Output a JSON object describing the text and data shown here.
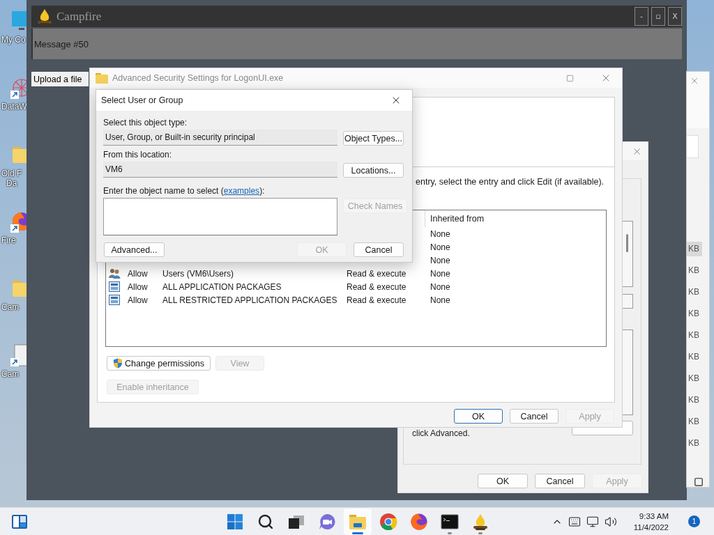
{
  "desktop": {
    "icons": [
      {
        "kind": "monitor",
        "shortcut": false,
        "lines": [
          "My Co"
        ]
      },
      {
        "kind": "web",
        "shortcut": true,
        "lines": [
          "DataW"
        ]
      },
      {
        "kind": "folder",
        "shortcut": false,
        "lines": [
          "Old F",
          "Da"
        ]
      },
      {
        "kind": "firefox",
        "shortcut": true,
        "lines": [
          "Fire"
        ]
      },
      {
        "kind": "folder",
        "shortcut": false,
        "lines": [
          "Cam"
        ]
      },
      {
        "kind": "file",
        "shortcut": true,
        "lines": [
          "Cam"
        ]
      }
    ]
  },
  "campfire": {
    "title": "Campfire",
    "controls": [
      "-",
      "▫",
      "X"
    ],
    "message": "Message #50",
    "upload_button": "Upload a file"
  },
  "right_window": {
    "rows": [
      {
        "size": "KB",
        "selected": true
      },
      {
        "size": "KB",
        "selected": false
      },
      {
        "size": "KB",
        "selected": false
      },
      {
        "size": "KB",
        "selected": false
      },
      {
        "size": "KB",
        "selected": false
      },
      {
        "size": "KB",
        "selected": false
      },
      {
        "size": "KB",
        "selected": false
      },
      {
        "size": "KB",
        "selected": false
      },
      {
        "size": "KB",
        "selected": false
      },
      {
        "size": "KB",
        "selected": false
      }
    ]
  },
  "properties_window": {
    "text": "click Advanced.",
    "footer": [
      {
        "label": "OK",
        "disabled": false
      },
      {
        "label": "Cancel",
        "disabled": false
      },
      {
        "label": "Apply",
        "disabled": true
      }
    ]
  },
  "security_window": {
    "title": "Advanced Security Settings for LogonUI.exe",
    "active": false,
    "instruction": "entry, select the entry and click Edit (if available).",
    "table": {
      "header": "Inherited from",
      "rows": [
        {
          "inherited": "None"
        },
        {
          "inherited": "None"
        },
        {
          "inherited": "None"
        },
        {
          "kind": "group",
          "type": "Allow",
          "principal": "Users (VM6\\Users)",
          "access": "Read & execute",
          "inherited": "None"
        },
        {
          "kind": "package",
          "type": "Allow",
          "principal": "ALL APPLICATION PACKAGES",
          "access": "Read & execute",
          "inherited": "None"
        },
        {
          "kind": "package",
          "type": "Allow",
          "principal": "ALL RESTRICTED APPLICATION PACKAGES",
          "access": "Read & execute",
          "inherited": "None"
        }
      ]
    },
    "buttons": [
      {
        "label": "Change permissions",
        "shield": true,
        "disabled": false
      },
      {
        "label": "View",
        "shield": false,
        "disabled": true
      }
    ],
    "inheritance_button": {
      "label": "Enable inheritance",
      "disabled": true
    },
    "footer": [
      {
        "label": "OK",
        "default": true,
        "disabled": false
      },
      {
        "label": "Cancel",
        "default": false,
        "disabled": false
      },
      {
        "label": "Apply",
        "default": false,
        "disabled": true
      }
    ]
  },
  "select_dialog": {
    "title": "Select User or Group",
    "object_type": {
      "label": "Select this object type:",
      "value": "User, Group, or Built-in security principal",
      "button": "Object Types..."
    },
    "location": {
      "label": "From this location:",
      "value": "VM6",
      "button": "Locations..."
    },
    "name_entry": {
      "prompt_before": "Enter the object name to select (",
      "link": "examples",
      "prompt_after": "):"
    },
    "check_names": {
      "label": "Check Names",
      "disabled": true
    },
    "advanced_button": "Advanced...",
    "ok": {
      "label": "OK",
      "disabled": true
    },
    "cancel": {
      "label": "Cancel",
      "disabled": false
    }
  },
  "taskbar": {
    "apps": [
      {
        "kind": "start",
        "active": false,
        "running": false
      },
      {
        "kind": "search",
        "active": false,
        "running": false
      },
      {
        "kind": "taskview",
        "active": false,
        "running": false
      },
      {
        "kind": "chat",
        "active": false,
        "running": false
      },
      {
        "kind": "explorer",
        "active": true,
        "running": true
      },
      {
        "kind": "chrome",
        "active": false,
        "running": false
      },
      {
        "kind": "firefox",
        "active": false,
        "running": false
      },
      {
        "kind": "terminal",
        "active": false,
        "running": true
      },
      {
        "kind": "campfire",
        "active": false,
        "running": true
      }
    ],
    "clock": {
      "time": "9:33 AM",
      "date": "11/4/2022"
    },
    "notifications": "1"
  }
}
